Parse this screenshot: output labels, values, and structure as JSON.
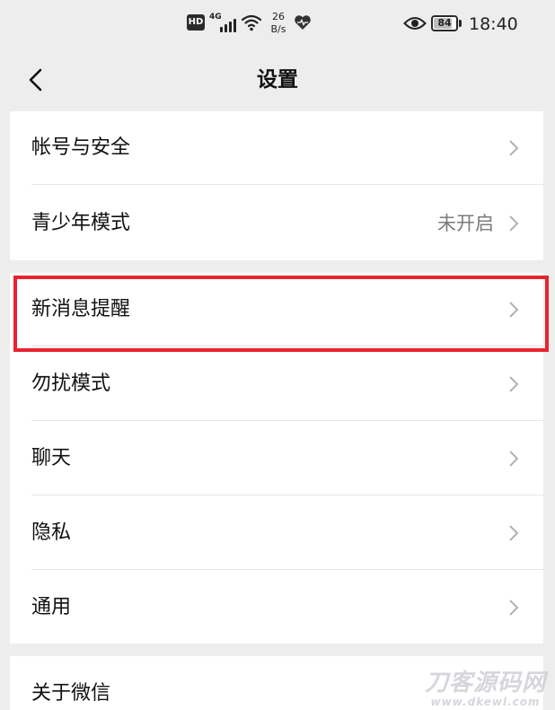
{
  "status_bar": {
    "hd": "HD",
    "network": "4G",
    "speed_value": "26",
    "speed_unit": "B/s",
    "battery": "84",
    "time": "18:40",
    "icons": [
      "hd-badge-icon",
      "signal-icon",
      "wifi-icon",
      "heart-rate-icon",
      "eye-icon",
      "battery-icon"
    ]
  },
  "nav": {
    "title": "设置",
    "back_icon": "chevron-left-icon"
  },
  "groups": [
    {
      "items": [
        {
          "label": "帐号与安全",
          "value": ""
        },
        {
          "label": "青少年模式",
          "value": "未开启"
        }
      ]
    },
    {
      "items": [
        {
          "label": "新消息提醒",
          "value": "",
          "highlighted": true
        },
        {
          "label": "勿扰模式",
          "value": ""
        },
        {
          "label": "聊天",
          "value": ""
        },
        {
          "label": "隐私",
          "value": ""
        },
        {
          "label": "通用",
          "value": ""
        }
      ]
    },
    {
      "items": [
        {
          "label": "关于微信",
          "value": ""
        }
      ]
    }
  ],
  "watermark": {
    "main": "刀客源码网",
    "sub": "www.dkewl.com"
  },
  "colors": {
    "background": "#ededed",
    "card": "#ffffff",
    "highlight": "#e8232f",
    "secondary_text": "#7b7b7b"
  }
}
